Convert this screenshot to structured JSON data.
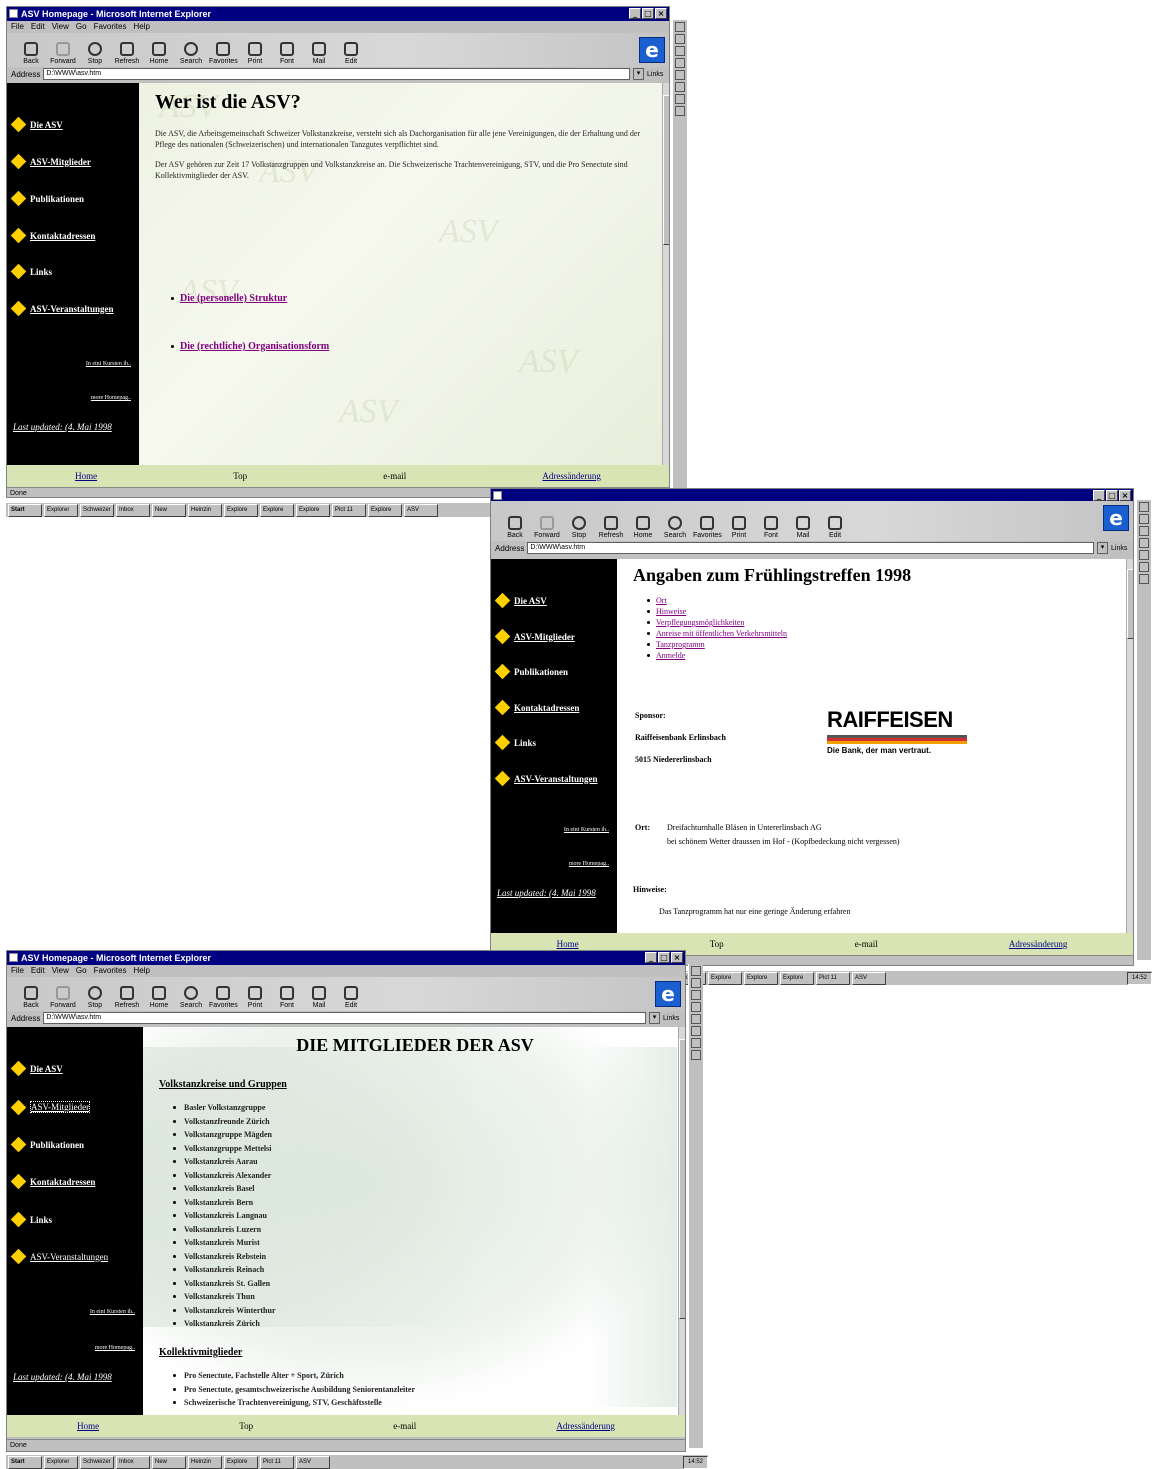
{
  "colors": {
    "title_bar": "#000080",
    "nav_bg": "#000000",
    "nav_diamond": "#ffd000",
    "footer_bg": "#d8e4b4",
    "link_visited": "#800080"
  },
  "menu": [
    "File",
    "Edit",
    "View",
    "Go",
    "Favorites",
    "Help"
  ],
  "toolbar": [
    "Back",
    "Forward",
    "Stop",
    "Refresh",
    "Home",
    "Search",
    "Favorites",
    "Print",
    "Font",
    "Mail",
    "Edit"
  ],
  "address_label": "Address",
  "links_label": "Links",
  "nav": {
    "items": [
      "Die ASV",
      "ASV-Mitglieder",
      "Publikationen",
      "Kontaktadressen",
      "Links",
      "ASV-Veranstaltungen"
    ],
    "small1": "In eini Kursten ih..",
    "small2": "more Homepag..",
    "last_updated": "Last updated: (4. Mai 1998"
  },
  "footer": {
    "home": "Home",
    "top": "Top",
    "email": "e-mail",
    "address_change": "Adressänderung"
  },
  "status_done": "Done",
  "taskbar": {
    "start": "Start",
    "items": [
      "Explorer",
      "Schweizer",
      "Inbox",
      "New",
      "Heinzin",
      "Explore",
      "Explore",
      "Explore",
      "Pict 11",
      "Explore",
      "ASV"
    ],
    "clock": "14:52"
  },
  "win1": {
    "title": "ASV Homepage - Microsoft Internet Explorer",
    "address": "D:\\WWW\\asv.htm",
    "heading": "Wer ist die ASV?",
    "para1": "Die ASV, die Arbeitsgemeinschaft Schweizer Volkstanzkreise, versteht sich als Dachorganisation für alle jene Vereinigungen, die der Erhaltung und der Pflege des nationalen (Schweizerischen) und internationalen Tanzgutes verpflichtet sind.",
    "para2": "Der ASV gehören zur Zeit 17 Volkstanzgruppen und Volkstanzkreise an. Die Schweizerische Trachtenvereinigung, STV, und die Pro Senectute sind Kollektivmitglieder der ASV.",
    "link1": "Die (personelle) Struktur",
    "link2": "Die (rechtliche) Organisationsform"
  },
  "win2": {
    "address": "D:\\WWW\\asv.htm",
    "heading": "Angaben zum Frühlingstreffen 1998",
    "links": [
      "Ort",
      "Hinweise",
      "Verpflegungsmöglichkeiten",
      "Anreise mit öffentlichen Verkehrsmitteln",
      "Tanzprogramm",
      "Anmelde"
    ],
    "sponsor_label": "Sponsor:",
    "sponsor_name": "Raiffeisenbank Erlinsbach",
    "sponsor_place": "5015 Niedererlinsbach",
    "logo_text": "RAIFFEISEN",
    "logo_slogan": "Die Bank, der man vertraut.",
    "ort_label": "Ort:",
    "ort_line1": "Dreifachturnhalle Bläsen in Untererlinsbach AG",
    "ort_line2": "bei schönem Wetter draussen im Hof - (Kopfbedeckung nicht vergessen)",
    "hinweis_label": "Hinweise:",
    "hinweis_text": "Das Tanzprogramm hat nur eine geringe Änderung erfahren"
  },
  "win3": {
    "title": "ASV Homepage - Microsoft Internet Explorer",
    "address": "D:\\WWW\\asv.htm",
    "heading": "DIE MITGLIEDER DER ASV",
    "section1": "Volkstanzkreise und Gruppen",
    "groups": [
      "Basler Volkstanzgruppe",
      "Volkstanzfreunde Zürich",
      "Volkstanzgruppe Mägden",
      "Volkstanzgruppe Mettelsi",
      "Volkstanzkreis Aarau",
      "Volkstanzkreis Alexander",
      "Volkstanzkreis Basel",
      "Volkstanzkreis Bern",
      "Volkstanzkreis Langnau",
      "Volkstanzkreis Luzern",
      "Volkstanzkreis Murist",
      "Volkstanzkreis Rebstein",
      "Volkstanzkreis Reinach",
      "Volkstanzkreis St. Gallen",
      "Volkstanzkreis Thun",
      "Volkstanzkreis Winterthur",
      "Volkstanzkreis Zürich"
    ],
    "section2": "Kollektivmitglieder",
    "collective": [
      "Pro Senectute, Fachstelle Alter + Sport, Zürich",
      "Pro Senectute, gesamtschweizerische Ausbildung Seniorentanzleiter",
      "Schweizerische Trachtenvereinigung, STV, Geschäftsstelle"
    ]
  }
}
